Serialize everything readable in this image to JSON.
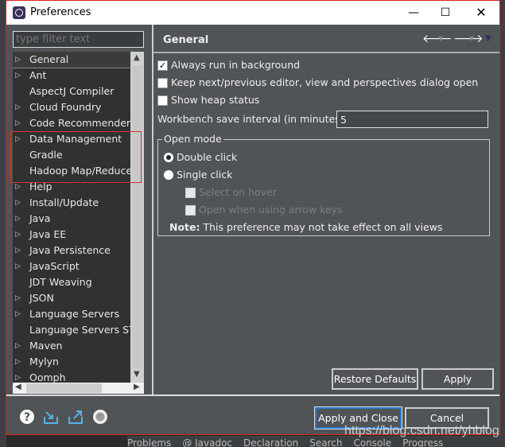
{
  "window": {
    "title": "Preferences",
    "controls": [
      "minimize",
      "maximize",
      "close"
    ]
  },
  "filter": {
    "placeholder": "type filter text",
    "value": ""
  },
  "tree": {
    "items": [
      {
        "label": "General",
        "expandable": true,
        "selected": true
      },
      {
        "label": "Ant",
        "expandable": true
      },
      {
        "label": "AspectJ Compiler",
        "expandable": false
      },
      {
        "label": "Cloud Foundry",
        "expandable": true
      },
      {
        "label": "Code Recommenders",
        "expandable": true
      },
      {
        "label": "Data Management",
        "expandable": true
      },
      {
        "label": "Gradle",
        "expandable": false
      },
      {
        "label": "Hadoop Map/Reduce",
        "expandable": false
      },
      {
        "label": "Help",
        "expandable": true
      },
      {
        "label": "Install/Update",
        "expandable": true
      },
      {
        "label": "Java",
        "expandable": true
      },
      {
        "label": "Java EE",
        "expandable": true
      },
      {
        "label": "Java Persistence",
        "expandable": true
      },
      {
        "label": "JavaScript",
        "expandable": true
      },
      {
        "label": "JDT Weaving",
        "expandable": false
      },
      {
        "label": "JSON",
        "expandable": true
      },
      {
        "label": "Language Servers",
        "expandable": true
      },
      {
        "label": "Language Servers STS",
        "expandable": false
      },
      {
        "label": "Maven",
        "expandable": true
      },
      {
        "label": "Mylyn",
        "expandable": true
      },
      {
        "label": "Oomph",
        "expandable": true
      }
    ]
  },
  "page": {
    "title": "General",
    "options": [
      {
        "label": "Always run in background",
        "checked": true
      },
      {
        "label": "Keep next/previous editor, view and perspectives dialog open",
        "checked": false
      },
      {
        "label": "Show heap status",
        "checked": false
      }
    ],
    "save_interval_label": "Workbench save interval (in minutes):",
    "save_interval_value": "5",
    "open_mode": {
      "label": "Open mode",
      "double_click": "Double click",
      "single_click": "Single click",
      "selected": "Double click",
      "select_on_hover": "Select on hover",
      "open_arrow_keys": "Open when using arrow keys",
      "note_bold": "Note:",
      "note": " This preference may not take effect on all views"
    },
    "restore_defaults": "Restore Defaults",
    "apply": "Apply"
  },
  "footer": {
    "apply_close": "Apply and Close",
    "cancel": "Cancel",
    "icons": [
      "help-icon",
      "import-icon",
      "export-icon",
      "record-icon"
    ]
  },
  "background": {
    "watermark": "https://blog.csdn.net/yhblog",
    "tabs": [
      "Problems",
      "@ Javadoc",
      "Declaration",
      "Search",
      "Console",
      "Progress"
    ]
  },
  "colors": {
    "annotation": "#e02020",
    "dialog_bg": "#505457",
    "default_button_border": "#2a7bd4"
  }
}
